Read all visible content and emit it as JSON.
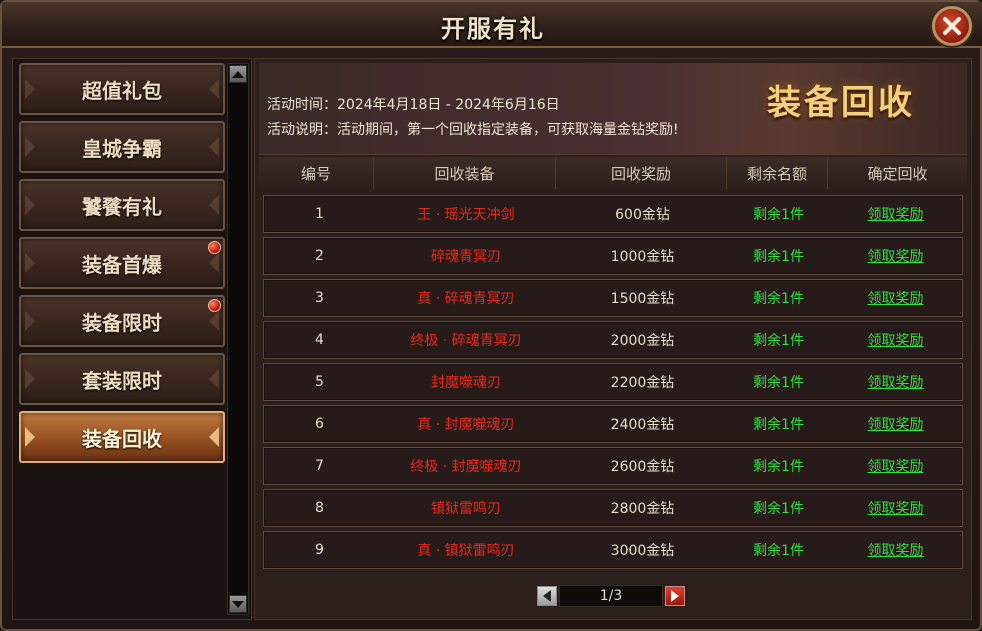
{
  "window": {
    "title": "开服有礼"
  },
  "sidebar": {
    "items": [
      {
        "label": "超值礼包",
        "badge": false,
        "active": false
      },
      {
        "label": "皇城争霸",
        "badge": false,
        "active": false
      },
      {
        "label": "饕餮有礼",
        "badge": false,
        "active": false
      },
      {
        "label": "装备首爆",
        "badge": true,
        "active": false
      },
      {
        "label": "装备限时",
        "badge": true,
        "active": false
      },
      {
        "label": "套装限时",
        "badge": false,
        "active": false
      },
      {
        "label": "装备回收",
        "badge": false,
        "active": true
      }
    ]
  },
  "banner": {
    "time_text": "活动时间：2024年4月18日 - 2024年6月16日",
    "desc_text": "活动说明：活动期间，第一个回收指定装备，可获取海量金钻奖励!",
    "title": "装备回收"
  },
  "table": {
    "headers": [
      "编号",
      "回收装备",
      "回收奖励",
      "剩余名额",
      "确定回收"
    ],
    "rows": [
      {
        "id": "1",
        "item": "王 · 瑶光天冲剑",
        "reward": "600金钻",
        "remain": "剩余1件",
        "action": "领取奖励"
      },
      {
        "id": "2",
        "item": "碎魂青冥刃",
        "reward": "1000金钻",
        "remain": "剩余1件",
        "action": "领取奖励"
      },
      {
        "id": "3",
        "item": "真 · 碎魂青冥刃",
        "reward": "1500金钻",
        "remain": "剩余1件",
        "action": "领取奖励"
      },
      {
        "id": "4",
        "item": "终极 · 碎魂青冥刃",
        "reward": "2000金钻",
        "remain": "剩余1件",
        "action": "领取奖励"
      },
      {
        "id": "5",
        "item": "封魔噬魂刃",
        "reward": "2200金钻",
        "remain": "剩余1件",
        "action": "领取奖励"
      },
      {
        "id": "6",
        "item": "真 · 封魔噬魂刃",
        "reward": "2400金钻",
        "remain": "剩余1件",
        "action": "领取奖励"
      },
      {
        "id": "7",
        "item": "终极 · 封魔噬魂刃",
        "reward": "2600金钻",
        "remain": "剩余1件",
        "action": "领取奖励"
      },
      {
        "id": "8",
        "item": "镇狱雷鸣刃",
        "reward": "2800金钻",
        "remain": "剩余1件",
        "action": "领取奖励"
      },
      {
        "id": "9",
        "item": "真 · 镇狱雷鸣刃",
        "reward": "3000金钻",
        "remain": "剩余1件",
        "action": "领取奖励"
      }
    ]
  },
  "pager": {
    "text": "1/3"
  },
  "colors": {
    "item_red": "#e8281c",
    "green": "#2ee040",
    "title_gold": "#f6cf7a"
  },
  "icons": {
    "close": "close-icon",
    "scroll_up": "arrow-up-icon",
    "scroll_down": "arrow-down-icon",
    "prev": "arrow-left-icon",
    "next": "arrow-right-icon"
  }
}
